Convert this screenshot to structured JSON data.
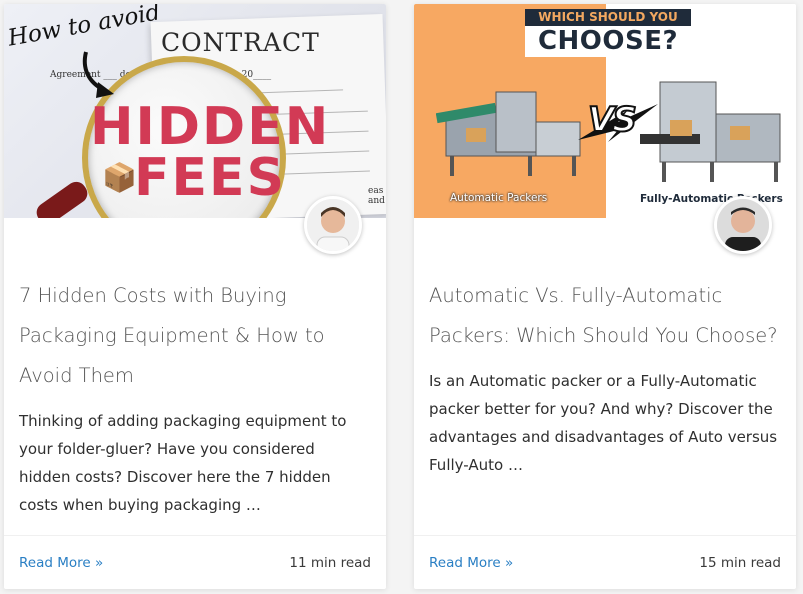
{
  "cards": [
    {
      "thumbnail": {
        "how_to_avoid": "How to avoid",
        "contract": "CONTRACT",
        "agreement_line": "Agreement ___ de the ____ day of ________ 20____",
        "hidden": "HIDDEN",
        "fees": "FEES",
        "side_text": "eas and"
      },
      "title": "7 Hidden Costs with Buying Packaging Equipment & How to Avoid Them",
      "excerpt": "Thinking of adding packaging equipment to your folder-gluer? Have you considered hidden costs? Discover here the 7 hidden costs when buying packaging …",
      "read_more": "Read More »",
      "read_time": "11 min read"
    },
    {
      "thumbnail": {
        "which_should_you": "WHICH SHOULD YOU",
        "choose": "CHOOSE?",
        "vs": "VS",
        "left_caption": "Automatic Packers",
        "right_caption": "Fully-Automatic Packers"
      },
      "title": "Automatic Vs. Fully-Automatic Packers: Which Should You Choose?",
      "excerpt": "Is an Automatic packer or a Fully-Automatic packer better for you? And why? Discover the advantages and disadvantages of Auto versus Fully-Auto …",
      "read_more": "Read More »",
      "read_time": "15 min read"
    }
  ],
  "colors": {
    "link": "#2a7fc4",
    "title": "#555555",
    "hidden_fees_red": "#d23a55",
    "thumbnail_orange": "#f7a862",
    "thumbnail_navy": "#1f2b3a"
  }
}
